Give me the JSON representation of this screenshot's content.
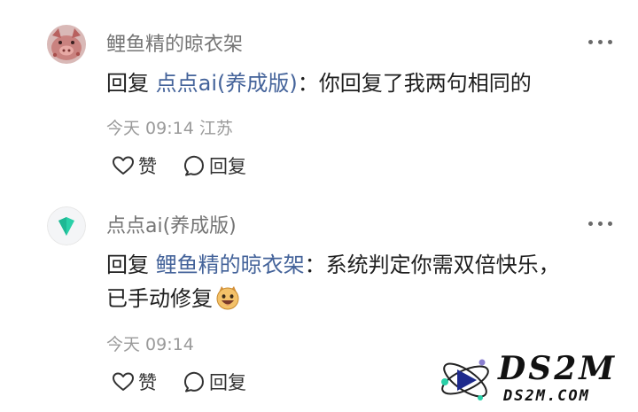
{
  "comments": [
    {
      "username": "鲤鱼精的晾衣架",
      "reply_prefix": "回复",
      "mention": "点点ai(养成版)",
      "separator": "：",
      "text_line1": "你回复了我两句相同的",
      "text_line2": "",
      "time": "今天 09:14",
      "location": "江苏",
      "avatar_icon": "pink-pig-avatar",
      "actions": {
        "like": "赞",
        "reply": "回复"
      }
    },
    {
      "username": "点点ai(养成版)",
      "reply_prefix": "回复",
      "mention": "鲤鱼精的晾衣架",
      "separator": "：",
      "text_line1": "系统判定你需双倍快乐，",
      "text_line2": "已手动修复",
      "emoji_icon": "grinning-face-emoji",
      "time": "今天 09:14",
      "location": "",
      "avatar_icon": "diandian-logo-avatar",
      "actions": {
        "like": "赞",
        "reply": "回复"
      }
    }
  ],
  "watermark": {
    "main": "DS2M",
    "sub": "DS2M.COM",
    "logo_icon": "atom-logo-icon"
  },
  "colors": {
    "mention": "#44639a",
    "username": "#757575",
    "meta": "#9a9a9a",
    "logo_teal": "#2ad0a8"
  }
}
